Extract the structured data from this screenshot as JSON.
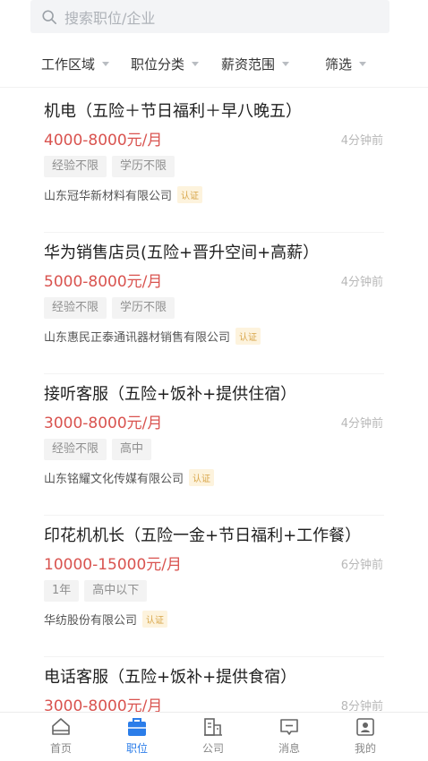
{
  "search": {
    "placeholder": "搜索职位/企业"
  },
  "filters": [
    "工作区域",
    "职位分类",
    "薪资范围",
    "筛选"
  ],
  "jobs": [
    {
      "title": "机电（五险＋节日福利＋早八晚五）",
      "salary": "4000-8000元/月",
      "time": "4分钟前",
      "tags": [
        "经验不限",
        "学历不限"
      ],
      "company": "山东冠华新材料有限公司",
      "badge": "认证"
    },
    {
      "title": "华为销售店员(五险+晋升空间+高薪）",
      "salary": "5000-8000元/月",
      "time": "4分钟前",
      "tags": [
        "经验不限",
        "学历不限"
      ],
      "company": "山东惠民正泰通讯器材销售有限公司",
      "badge": "认证"
    },
    {
      "title": "接听客服（五险+饭补+提供住宿）",
      "salary": "3000-8000元/月",
      "time": "4分钟前",
      "tags": [
        "经验不限",
        "高中"
      ],
      "company": "山东铭耀文化传媒有限公司",
      "badge": "认证"
    },
    {
      "title": "印花机机长（五险一金+节日福利+工作餐）",
      "salary": "10000-15000元/月",
      "time": "6分钟前",
      "tags": [
        "1年",
        "高中以下"
      ],
      "company": "华纺股份有限公司",
      "badge": "认证"
    },
    {
      "title": "电话客服（五险+饭补+提供食宿）",
      "salary": "3000-8000元/月",
      "time": "8分钟前",
      "tags": [],
      "company": "",
      "badge": ""
    }
  ],
  "tabbar": [
    {
      "label": "首页",
      "icon": "home-icon",
      "active": false
    },
    {
      "label": "职位",
      "icon": "briefcase-icon",
      "active": true
    },
    {
      "label": "公司",
      "icon": "building-icon",
      "active": false
    },
    {
      "label": "消息",
      "icon": "message-icon",
      "active": false
    },
    {
      "label": "我的",
      "icon": "profile-icon",
      "active": false
    }
  ],
  "colors": {
    "accent": "#2b7de9",
    "salary": "#d9534f",
    "badge_text": "#d8a64a",
    "badge_bg": "#fdf3dd"
  }
}
